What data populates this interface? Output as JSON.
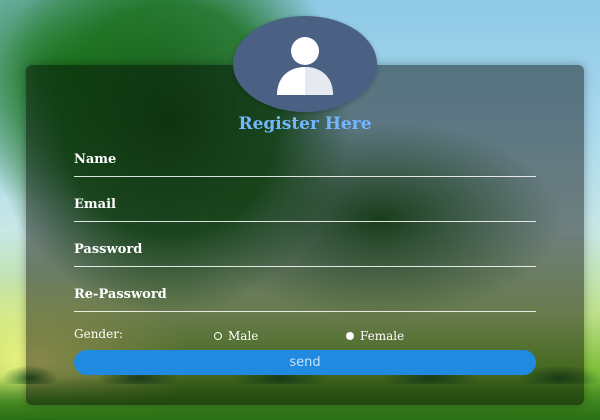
{
  "form": {
    "title": "Register Here",
    "fields": [
      {
        "label": "Name"
      },
      {
        "label": "Email"
      },
      {
        "label": "Password"
      },
      {
        "label": "Re-Password"
      }
    ],
    "gender": {
      "label": "Gender:",
      "options": [
        {
          "label": "Male",
          "selected": false
        },
        {
          "label": "Female",
          "selected": true
        }
      ]
    },
    "submit_label": "send"
  },
  "colors": {
    "avatar_bg": "#4a6184",
    "title": "#72b7ff",
    "button": "#1f8ae0",
    "card_overlay": "rgba(0,0,0,0.45)"
  },
  "icons": {
    "avatar": "user-avatar-icon",
    "radio_unchecked": "radio-unchecked-icon",
    "radio_checked": "radio-checked-icon"
  }
}
